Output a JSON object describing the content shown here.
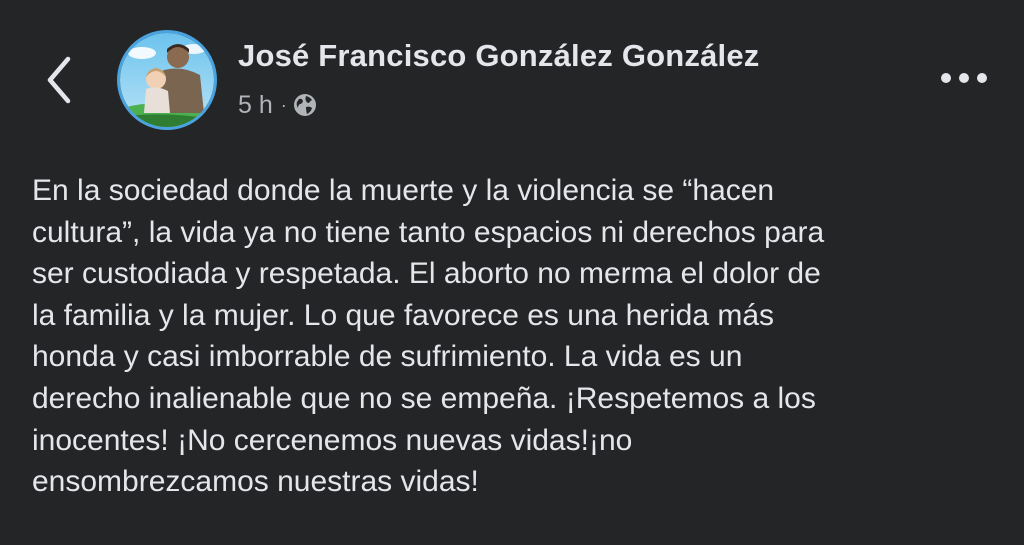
{
  "header": {
    "author_name": "José Francisco González González",
    "timestamp": "5 h",
    "separator": "·",
    "audience_icon": "globe-icon",
    "back_icon": "chevron-left-icon",
    "more_icon": "more-horizontal-icon"
  },
  "post": {
    "text": "En la sociedad donde la muerte y la violencia se “hacen\ncultura”, la vida ya no tiene tanto espacios ni derechos para\nser custodiada y respetada. El aborto no merma el dolor de\nla familia y la mujer. Lo que favorece es una herida más\nhonda y casi imborrable de sufrimiento. La vida es un\nderecho inalienable que no se empeña. ¡Respetemos a los\ninocentes! ¡No cercenemos nuevas vidas!¡no\nensombrezcamos nuestras vidas!"
  },
  "colors": {
    "background": "#242526",
    "primary_text": "#e4e6eb",
    "secondary_text": "#b0b3b8",
    "avatar_ring": "#4aa3df"
  }
}
